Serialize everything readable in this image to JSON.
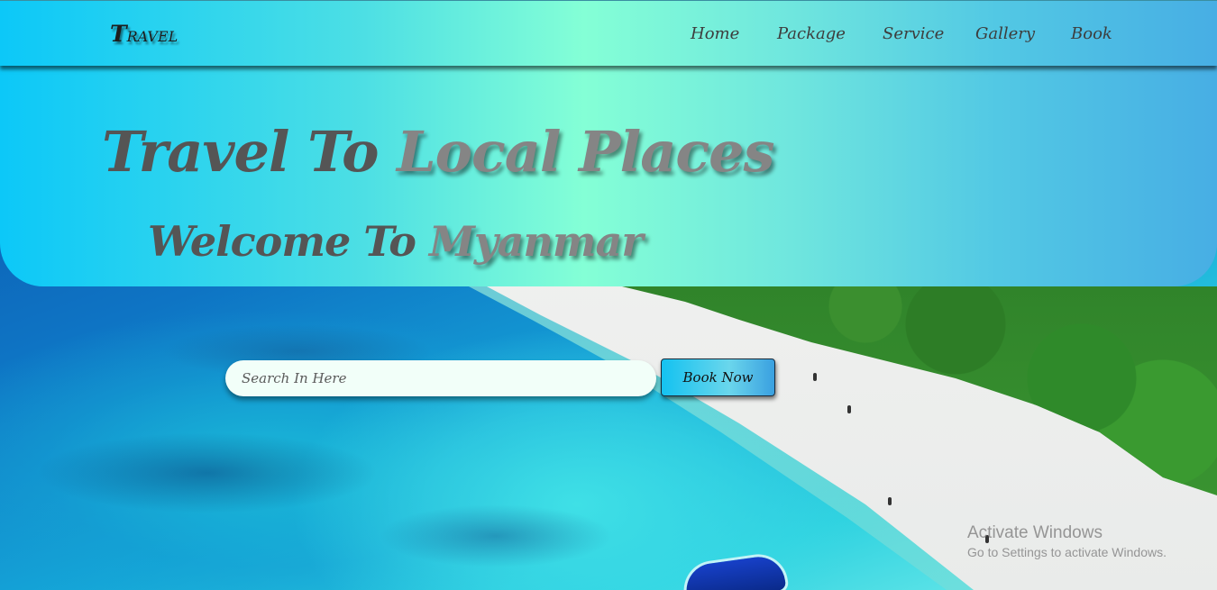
{
  "brand": {
    "logo_initial": "T",
    "logo_rest": "RAVEL"
  },
  "nav": {
    "items": [
      {
        "label": "Home"
      },
      {
        "label": "Package"
      },
      {
        "label": "Service"
      },
      {
        "label": "Gallery"
      },
      {
        "label": "Book"
      }
    ]
  },
  "hero": {
    "line1_part1": "Travel To ",
    "line1_part2": "Local Places",
    "line2_part1": "Welcome To ",
    "line2_part2": "Myanmar"
  },
  "search": {
    "placeholder": "Search In Here",
    "value": ""
  },
  "book_button": {
    "label": "Book Now"
  },
  "watermark": {
    "title": "Activate Windows",
    "subtitle": "Go to Settings to activate Windows."
  },
  "colors": {
    "gradient_left": "#0cc8f8",
    "gradient_mid": "#84ffd6",
    "gradient_right": "#47aee4",
    "title_dark": "#555555",
    "title_light": "#858585"
  }
}
